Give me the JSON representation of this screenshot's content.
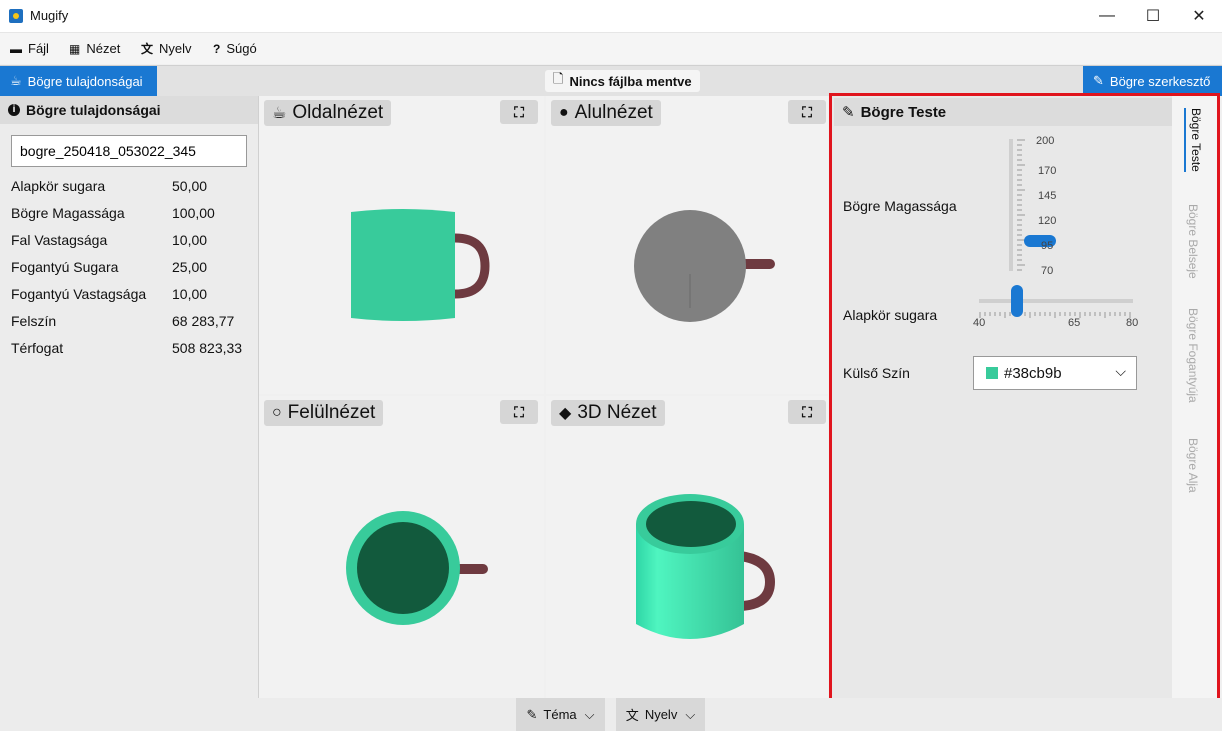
{
  "window": {
    "title": "Mugify",
    "controls": {
      "minimize": "—",
      "maximize": "☐",
      "close": "✕"
    }
  },
  "menu": [
    {
      "label": "Fájl",
      "icon": "folder-icon"
    },
    {
      "label": "Nézet",
      "icon": "grid-icon"
    },
    {
      "label": "Nyelv",
      "icon": "translate-icon"
    },
    {
      "label": "Súgó",
      "icon": "help-icon"
    }
  ],
  "tabs": {
    "left": "Bögre tulajdonságai",
    "status": "Nincs fájlba mentve",
    "right": "Bögre szerkesztő"
  },
  "properties": {
    "title": "Bögre tulajdonságai",
    "name_value": "bogre_250418_053022_345",
    "rows": [
      {
        "label": "Alapkör sugara",
        "value": "50,00"
      },
      {
        "label": "Bögre Magassága",
        "value": "100,00"
      },
      {
        "label": "Fal Vastagsága",
        "value": "10,00"
      },
      {
        "label": "Fogantyú Sugara",
        "value": "25,00"
      },
      {
        "label": "Fogantyú Vastagsága",
        "value": "10,00"
      },
      {
        "label": "Felszín",
        "value": "68 283,77"
      },
      {
        "label": "Térfogat",
        "value": "508 823,33"
      }
    ]
  },
  "views": {
    "side": {
      "label": "Oldalnézet"
    },
    "bottom": {
      "label": "Alulnézet"
    },
    "top": {
      "label": "Felülnézet"
    },
    "three_d": {
      "label": "3D Nézet"
    }
  },
  "editor": {
    "title": "Bögre Teste",
    "height": {
      "label": "Bögre Magassága",
      "ticks": [
        "200",
        "170",
        "145",
        "120",
        "95",
        "70"
      ],
      "min": 70,
      "max": 200,
      "value": 100
    },
    "radius": {
      "label": "Alapkör sugara",
      "ticks": [
        "40",
        "65",
        "80"
      ],
      "min": 40,
      "max": 80,
      "value": 50
    },
    "color": {
      "label": "Külső Szín",
      "value": "#38cb9b"
    }
  },
  "vertical_tabs": [
    "Bögre Teste",
    "Bögre Belseje",
    "Bögre Fogantyúja",
    "Bögre Alja"
  ],
  "bottom": {
    "theme": "Téma",
    "language": "Nyelv"
  },
  "colors": {
    "accent": "#1a78d2",
    "mug": "#38cb9b",
    "mug_inner": "#125a3d",
    "handle": "#6e3a40",
    "highlight": "#e0141d"
  }
}
